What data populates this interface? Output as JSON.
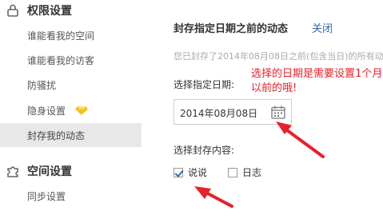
{
  "sidebar": {
    "privacy_section": {
      "title": "权限设置",
      "icon": "lock-icon"
    },
    "items": [
      {
        "label": "谁能看我的空间"
      },
      {
        "label": "谁能看我的访客"
      },
      {
        "label": "防骚扰"
      },
      {
        "label": "隐身设置",
        "badge_icon": "yellow-diamond-icon"
      },
      {
        "label": "封存我的动态",
        "active": true
      }
    ],
    "space_section": {
      "title": "空间设置",
      "icon": "puzzle-icon"
    },
    "space_items": [
      {
        "label": "同步设置"
      }
    ]
  },
  "main": {
    "title": "封存指定日期之前的动态",
    "close_label": "关闭",
    "description": "您已封存了2014年08月08日之前(包含当日)的所有动态",
    "date_label": "选择指定日期:",
    "date_value": "2014年08月08日",
    "content_label": "选择封存内容:",
    "options": [
      {
        "label": "说说",
        "checked": true
      },
      {
        "label": "日志",
        "checked": false
      }
    ],
    "annotation": "选择的日期是需要设置1个月以前的哦!"
  },
  "colors": {
    "accent_link": "#3366aa",
    "annotation_red": "#e8202a",
    "active_bg": "#e8e8e8",
    "check_blue": "#2a6db5"
  }
}
